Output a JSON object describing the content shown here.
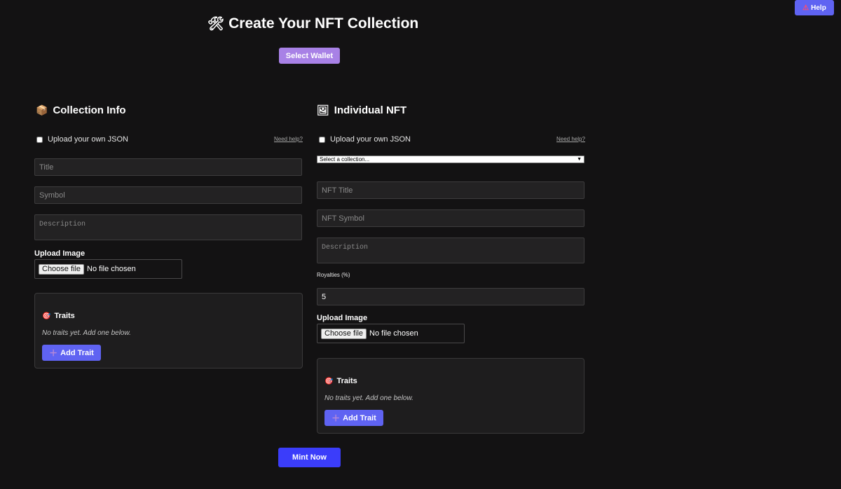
{
  "header": {
    "help_label": "Help",
    "help_icon": "warning-icon",
    "title": "Create Your NFT Collection",
    "title_icon": "tools-icon",
    "wallet_button": "Select Wallet"
  },
  "collection": {
    "section_title": "Collection Info",
    "section_icon": "package-icon",
    "upload_json_label": "Upload your own JSON",
    "need_help": "Need help?",
    "title_placeholder": "Title",
    "symbol_placeholder": "Symbol",
    "description_placeholder": "Description",
    "upload_image_label": "Upload Image",
    "choose_file": "Choose file",
    "no_file": "No file chosen",
    "traits_title": "Traits",
    "traits_empty": "No traits yet. Add one below.",
    "add_trait": "Add Trait"
  },
  "nft": {
    "section_title": "Individual NFT",
    "section_icon": "picture-icon",
    "upload_json_label": "Upload your own JSON",
    "need_help": "Need help?",
    "collection_select": "Select a collection...",
    "title_placeholder": "NFT Title",
    "symbol_placeholder": "NFT Symbol",
    "description_placeholder": "Description",
    "royalties_label": "Royalties (%)",
    "royalties_value": "5",
    "upload_image_label": "Upload Image",
    "choose_file": "Choose file",
    "no_file": "No file chosen",
    "traits_title": "Traits",
    "traits_empty": "No traits yet. Add one below.",
    "add_trait": "Add Trait"
  },
  "footer": {
    "mint_button": "Mint Now"
  },
  "colors": {
    "background": "#131213",
    "primary": "#5f63f2",
    "wallet": "#a881e6",
    "mint": "#3b3dfa"
  }
}
